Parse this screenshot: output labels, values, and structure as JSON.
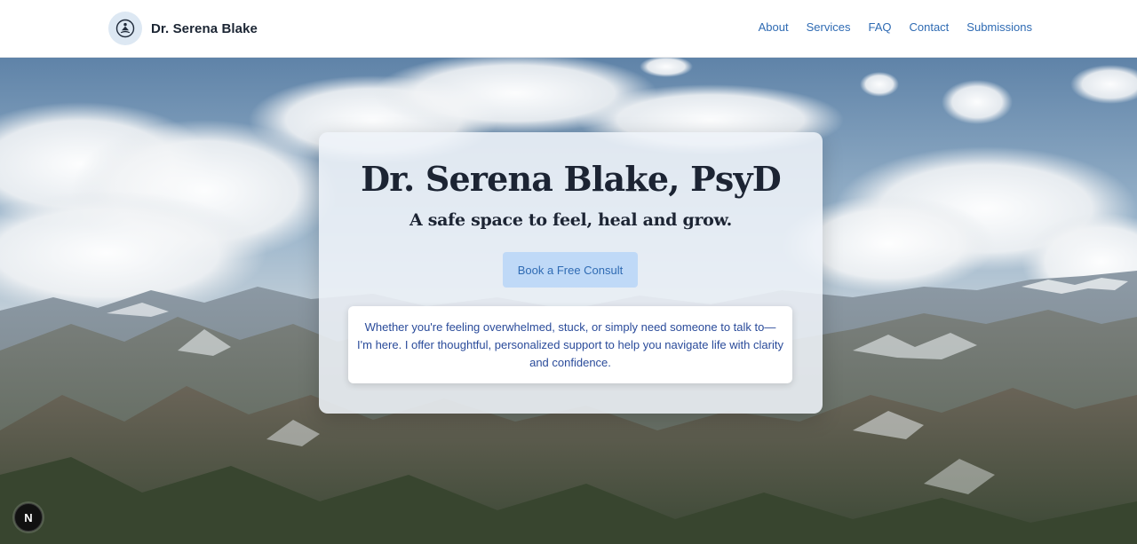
{
  "header": {
    "brand_name": "Dr. Serena Blake",
    "logo_icon": "meditation-figure-icon",
    "nav": [
      {
        "label": "About"
      },
      {
        "label": "Services"
      },
      {
        "label": "FAQ"
      },
      {
        "label": "Contact"
      },
      {
        "label": "Submissions"
      }
    ]
  },
  "hero": {
    "background_image": "mountain-landscape-with-clouds",
    "title": "Dr. Serena Blake, PsyD",
    "subtitle": "A safe space to feel, heal and grow.",
    "cta_label": "Book a Free Consult",
    "intro_text": "Whether you're feeling overwhelmed, stuck, or simply need someone to talk to— I'm here. I offer thoughtful, personalized support to help you navigate life with clarity and confidence."
  },
  "dev_badge": {
    "label": "N"
  },
  "colors": {
    "nav_link": "#2f6bb3",
    "brand_text": "#1b2533",
    "cta_bg": "#bfd9f7",
    "intro_text": "#2a4b9a",
    "heading": "#1c2433"
  }
}
